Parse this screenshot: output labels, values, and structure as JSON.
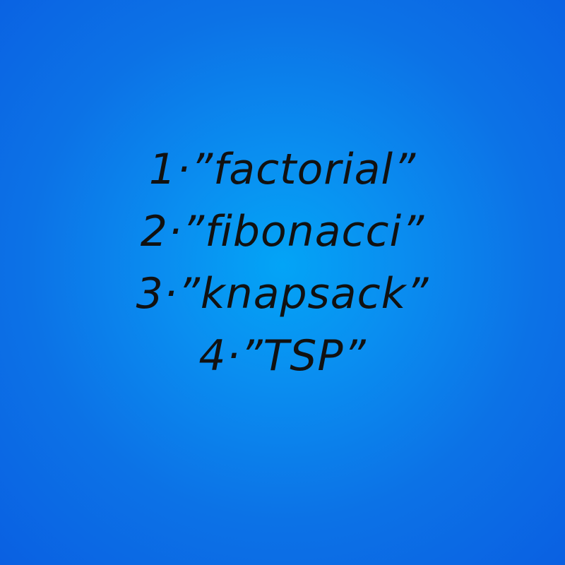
{
  "background": {
    "center_color": "#03a4f6",
    "edge_color": "#0a60e2"
  },
  "text_color": "#111111",
  "items": [
    {
      "text": "1·”factorial”"
    },
    {
      "text": "2·”fibonacci”"
    },
    {
      "text": "3·”knapsack”"
    },
    {
      "text": "4·”TSP”"
    }
  ]
}
